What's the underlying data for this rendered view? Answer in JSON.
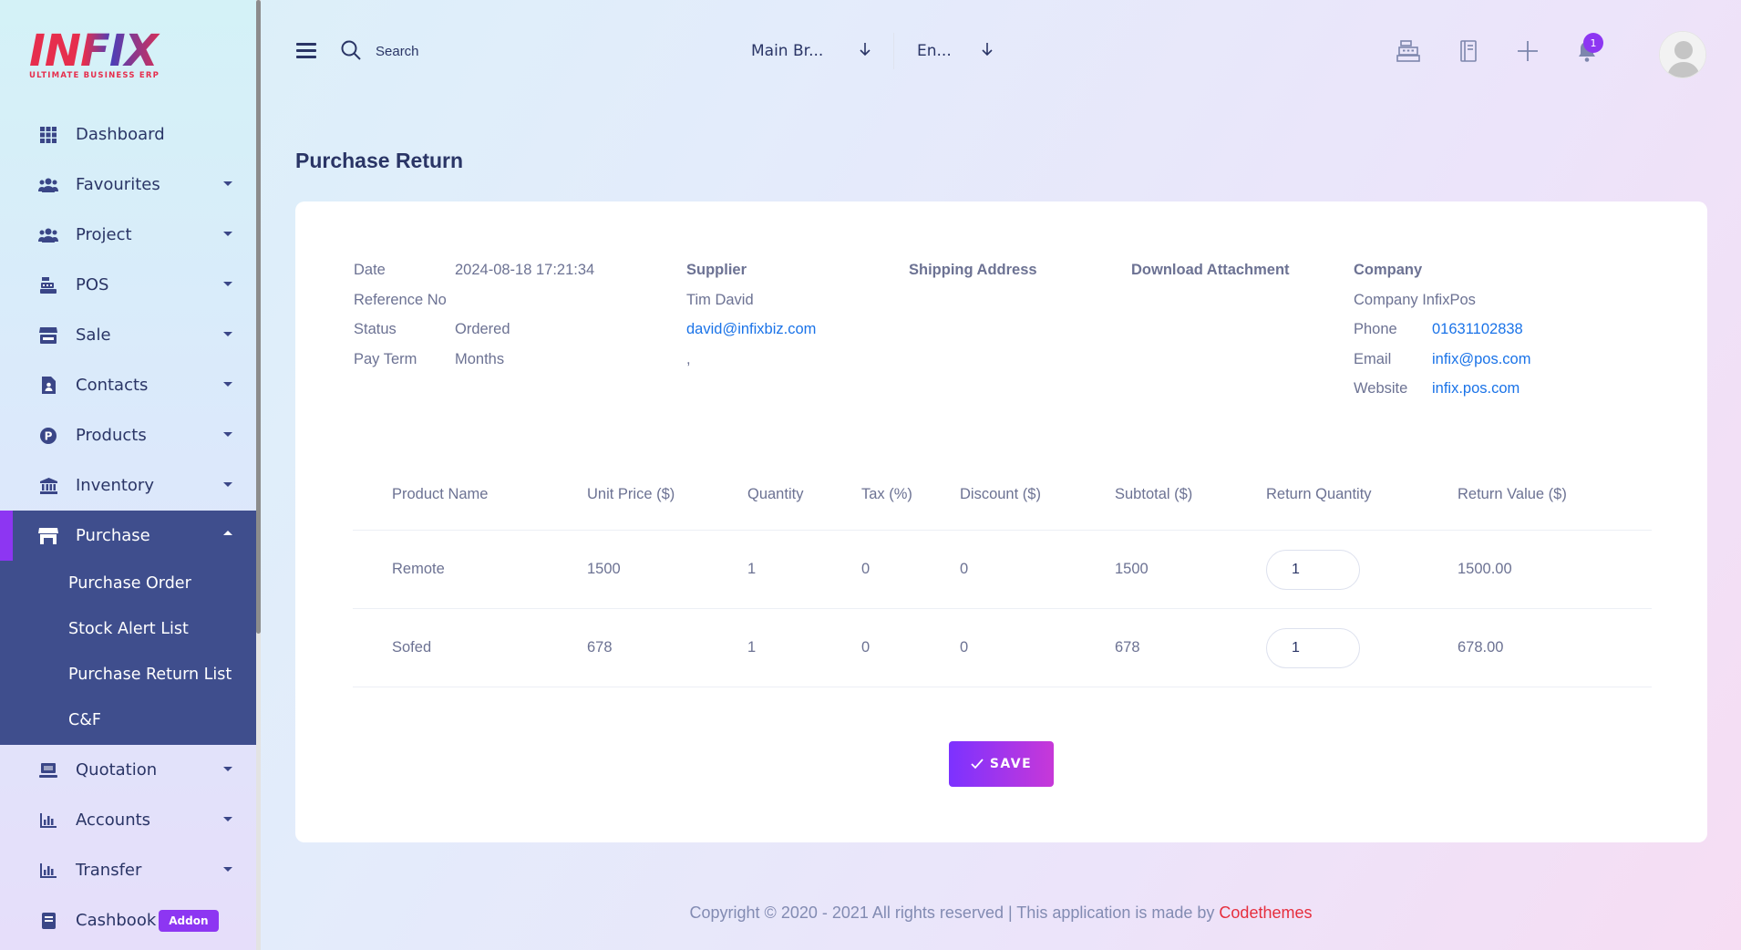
{
  "app": {
    "logo_text": "INFIX",
    "logo_subtitle": "ULTIMATE BUSINESS ERP",
    "brand_red": "#e62e4d",
    "accent": "#8d36f2",
    "nav_active_bg": "#3f4e8d"
  },
  "sidebar": {
    "items": [
      {
        "label": "Dashboard",
        "icon": "grid-icon"
      },
      {
        "label": "Favourites",
        "icon": "users-icon"
      },
      {
        "label": "Project",
        "icon": "users-icon"
      },
      {
        "label": "POS",
        "icon": "cash-register-icon"
      },
      {
        "label": "Sale",
        "icon": "store-icon"
      },
      {
        "label": "Contacts",
        "icon": "contact-file-icon"
      },
      {
        "label": "Products",
        "icon": "product-p-icon"
      },
      {
        "label": "Inventory",
        "icon": "bank-icon"
      },
      {
        "label": "Purchase",
        "icon": "shop-icon"
      },
      {
        "label": "Quotation",
        "icon": "keyboard-icon"
      },
      {
        "label": "Accounts",
        "icon": "chart-icon"
      },
      {
        "label": "Transfer",
        "icon": "chart-icon"
      },
      {
        "label": "Cashbook",
        "icon": "book-icon"
      }
    ],
    "purchase_submenu": [
      "Purchase Order",
      "Stock Alert List",
      "Purchase Return List",
      "C&F"
    ],
    "addon_badge": "Addon"
  },
  "topbar": {
    "search_placeholder": "Search",
    "branch_select": "Main Br...",
    "language_select": "En...",
    "notification_count": "1"
  },
  "page": {
    "title": "Purchase Return"
  },
  "info": {
    "date_label": "Date",
    "date_value": "2024-08-18 17:21:34",
    "reference_label": "Reference No",
    "status_label": "Status",
    "status_value": "Ordered",
    "payterm_label": "Pay Term",
    "payterm_value": "Months",
    "supplier_heading": "Supplier",
    "supplier_name": "Tim David",
    "supplier_email": "david@infixbiz.com",
    "supplier_extra": ",",
    "shipping_heading": "Shipping Address",
    "attachment_heading": "Download Attachment",
    "company_heading": "Company",
    "company_name": "Company InfixPos",
    "phone_label": "Phone",
    "phone_value": "01631102838",
    "email_label": "Email",
    "email_value": "infix@pos.com",
    "website_label": "Website",
    "website_value": "infix.pos.com"
  },
  "table": {
    "headers": [
      "Product Name",
      "Unit Price ($)",
      "Quantity",
      "Tax (%)",
      "Discount ($)",
      "Subtotal ($)",
      "Return Quantity",
      "Return Value ($)"
    ],
    "rows": [
      {
        "product": "Remote",
        "unit_price": "1500",
        "quantity": "1",
        "tax": "0",
        "discount": "0",
        "subtotal": "1500",
        "return_qty": "1",
        "return_value": "1500.00"
      },
      {
        "product": "Sofed",
        "unit_price": "678",
        "quantity": "1",
        "tax": "0",
        "discount": "0",
        "subtotal": "678",
        "return_qty": "1",
        "return_value": "678.00"
      }
    ]
  },
  "actions": {
    "save_label": "SAVE"
  },
  "footer": {
    "text": "Copyright © 2020 - 2021 All rights reserved | This application is made by ",
    "brand": "Codethemes"
  }
}
